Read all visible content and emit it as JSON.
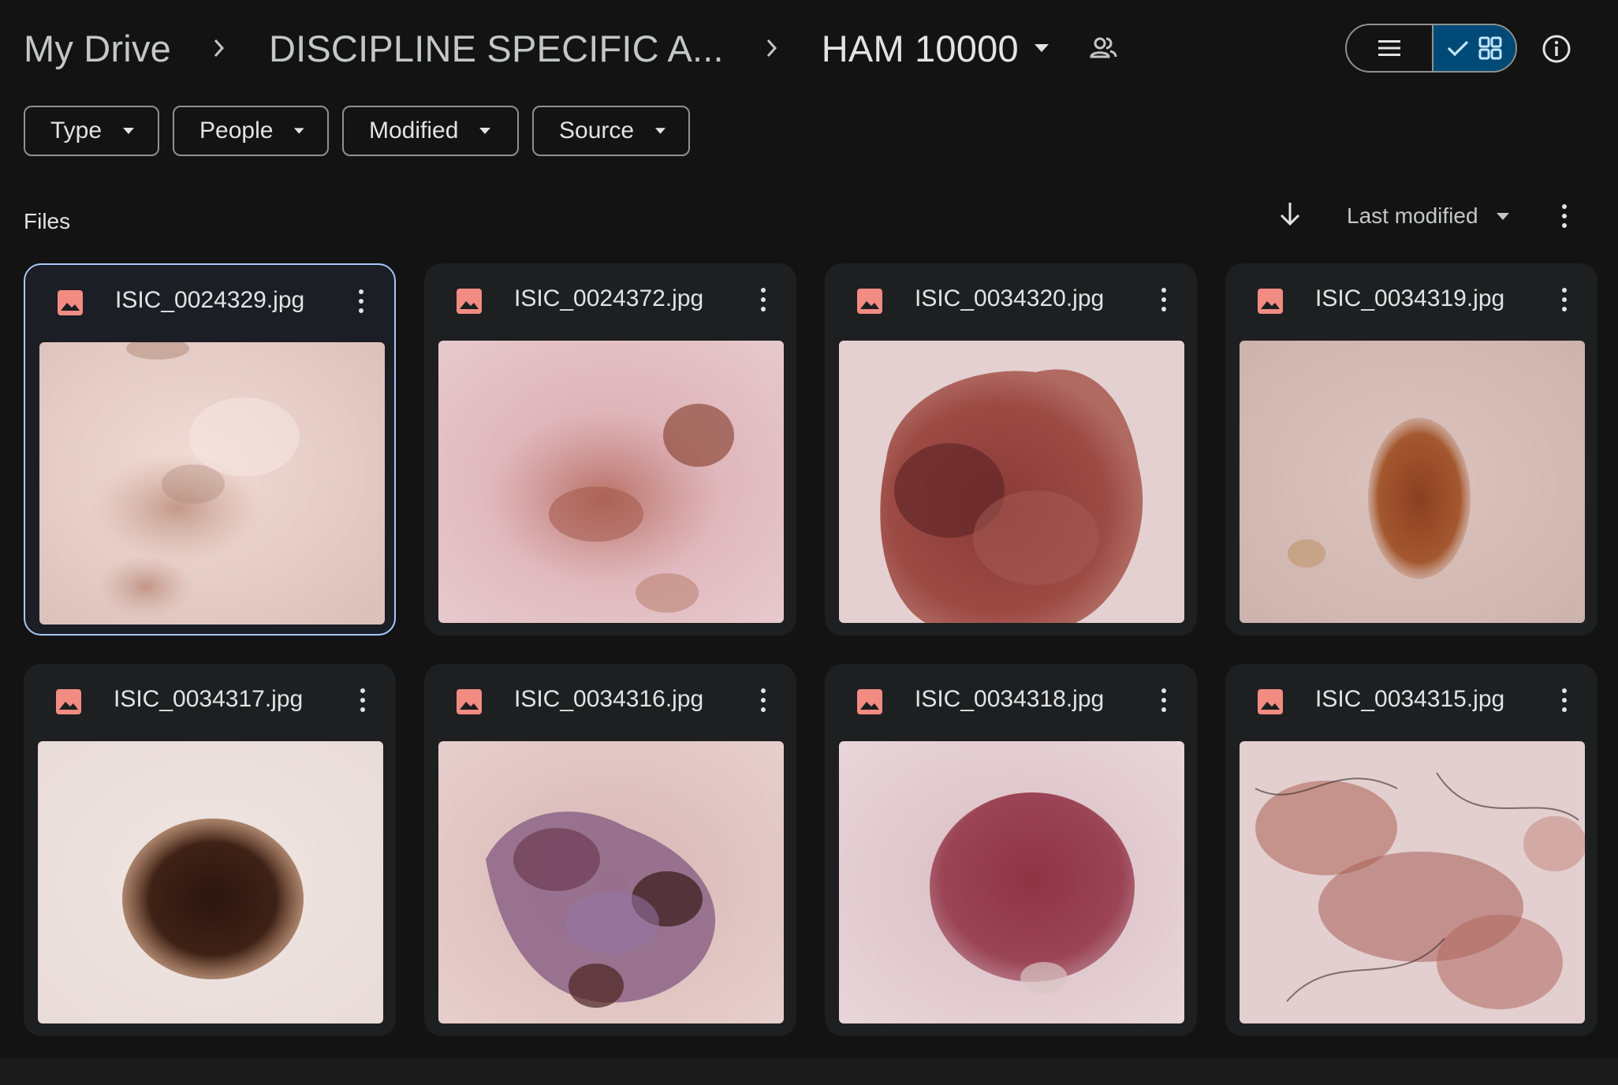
{
  "breadcrumb": {
    "root": "My Drive",
    "parent": "DISCIPLINE SPECIFIC A...",
    "current": "HAM 10000"
  },
  "filters": [
    "Type",
    "People",
    "Modified",
    "Source"
  ],
  "files_label": "Files",
  "sort": {
    "label": "Last modified",
    "direction": "descending"
  },
  "view": {
    "mode": "grid"
  },
  "files": [
    {
      "name": "ISIC_0024329.jpg",
      "selected": true
    },
    {
      "name": "ISIC_0024372.jpg",
      "selected": false
    },
    {
      "name": "ISIC_0034320.jpg",
      "selected": false
    },
    {
      "name": "ISIC_0034319.jpg",
      "selected": false
    },
    {
      "name": "ISIC_0034317.jpg",
      "selected": false
    },
    {
      "name": "ISIC_0034316.jpg",
      "selected": false
    },
    {
      "name": "ISIC_0034318.jpg",
      "selected": false
    },
    {
      "name": "ISIC_0034315.jpg",
      "selected": false
    }
  ],
  "colors": {
    "background": "#131313",
    "card": "#1e1f20",
    "selection_border": "#a8c7fa",
    "active_toggle": "#004a77",
    "image_file_icon": "#f28b82"
  }
}
